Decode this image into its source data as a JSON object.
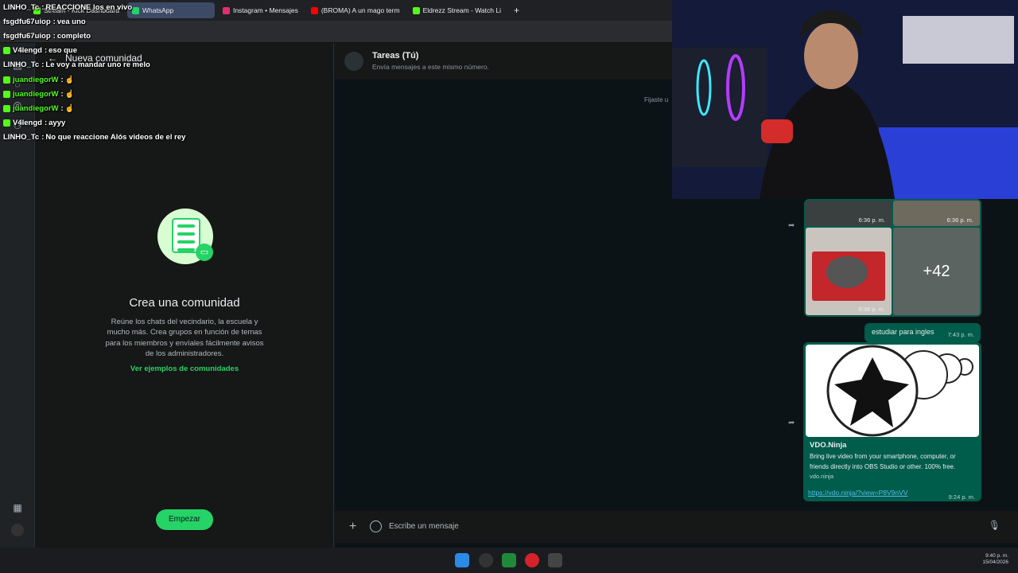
{
  "browser": {
    "tabs": [
      {
        "label": "Stream - Kick Dashboard",
        "color": "#53fc18"
      },
      {
        "label": "WhatsApp",
        "color": "#25d366",
        "active": true
      },
      {
        "label": "Instagram • Mensajes",
        "color": "#e1306c"
      },
      {
        "label": "(BROMA) A un mago term",
        "color": "#ff0000"
      },
      {
        "label": "Eldrezz Stream - Watch Li",
        "color": "#53fc18"
      }
    ],
    "new_tab": "+"
  },
  "whatsapp": {
    "panel": {
      "header_title": "Nueva comunidad",
      "community_title": "Crea una comunidad",
      "community_description": "Reúne los chats del vecindario, la escuela y mucho más. Crea grupos en función de temas para los miembros y envíales fácilmente avisos de los administradores.",
      "examples_link": "Ver ejemplos de comunidades",
      "start_button": "Empezar"
    },
    "chat": {
      "name": "Tareas (Tú)",
      "subtitle": "Envía mensajes a este mismo número.",
      "pinned_hint": "Fijaste u",
      "media_times": [
        "6:36 p. m.",
        "6:36 p. m.",
        "6:36 p. m."
      ],
      "more_count": "+42",
      "text_message": {
        "text": "estudiar para ingles",
        "time": "7:43 p. m."
      },
      "link_message": {
        "title": "VDO.Ninja",
        "description": "Bring live video from your smartphone, computer, or friends directly into OBS Studio or other. 100% free.",
        "domain": "vdo.ninja",
        "url": "https://vdo.ninja/?view=P8V9nVV",
        "time": "9:24 p. m."
      },
      "composer_placeholder": "Escribe un mensaje"
    }
  },
  "stream_chat": [
    {
      "user": "LINHO_Tc",
      "text": "REACCIONE los en vivo",
      "badge": false,
      "color": "#ffffff"
    },
    {
      "user": "fsgdfu67uiop",
      "text": "vea uno",
      "badge": false,
      "color": "#ffffff"
    },
    {
      "user": "fsgdfu67uiop",
      "text": "completo",
      "badge": false,
      "color": "#ffffff"
    },
    {
      "user": "V4lengd",
      "text": "eso que",
      "badge": true,
      "color": "#ffffff"
    },
    {
      "user": "LINHO_Tc",
      "text": "Le voy a mandar uno re melo",
      "badge": false,
      "color": "#ffffff"
    },
    {
      "user": "juandiegorW",
      "text": "☝",
      "badge": true,
      "color": "#53fc18"
    },
    {
      "user": "juandiegorW",
      "text": "☝",
      "badge": true,
      "color": "#53fc18"
    },
    {
      "user": "juandiegorW",
      "text": "☝",
      "badge": true,
      "color": "#53fc18"
    },
    {
      "user": "V4lengd",
      "text": "ayyy",
      "badge": true,
      "color": "#ffffff"
    },
    {
      "user": "LINHO_Tc",
      "text": "No que reaccione Alós videos de el rey",
      "badge": false,
      "color": "#ffffff"
    }
  ],
  "taskbar": {
    "icons": [
      "windows-start-icon",
      "search-icon",
      "xbox-icon",
      "opera-icon",
      "obs-icon"
    ],
    "time": "9:40 p. m.",
    "date": "15/04/2026"
  },
  "colors": {
    "accent": "#25d366",
    "bubble": "#005c4b",
    "kick": "#53fc18"
  }
}
